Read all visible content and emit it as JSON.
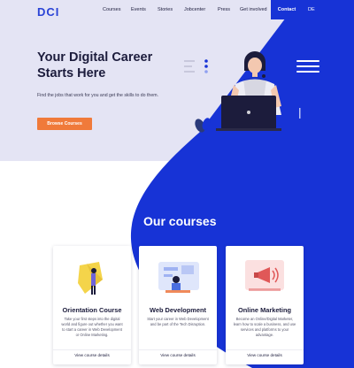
{
  "brand": {
    "logo_text": "DCI"
  },
  "nav": {
    "items": [
      "Courses",
      "Events",
      "Stories",
      "Jobcenter",
      "Press",
      "Get involved"
    ],
    "contact_label": "Contact",
    "language": "DE"
  },
  "hero": {
    "title": "Your Digital Career Starts Here",
    "subtitle": "Find the jobs that work for you and get the skills to do them.",
    "cta_label": "Browse Courses"
  },
  "courses": {
    "heading": "Our courses",
    "cards": [
      {
        "title": "Orientation Course",
        "text": "Take your first steps into the digital world and figure out whether you want to start a career in Web Development or Online Marketing.",
        "link_label": "View course details"
      },
      {
        "title": "Web Development",
        "text": "Start your career in Web Development and be part of the Tech Disruption.",
        "link_label": "View course details"
      },
      {
        "title": "Online Marketing",
        "text": "Become an Online/Digital Marketer, learn how to scale a business, and use services and platforms to your advantage.",
        "link_label": "View course details"
      }
    ]
  },
  "colors": {
    "brand_blue": "#1733d6",
    "hero_bg": "#e4e4f4",
    "cta_orange": "#f07a3a",
    "text_dark": "#1c1c3c"
  },
  "icons": [
    "menu-icon",
    "person-laptop-illustration"
  ]
}
